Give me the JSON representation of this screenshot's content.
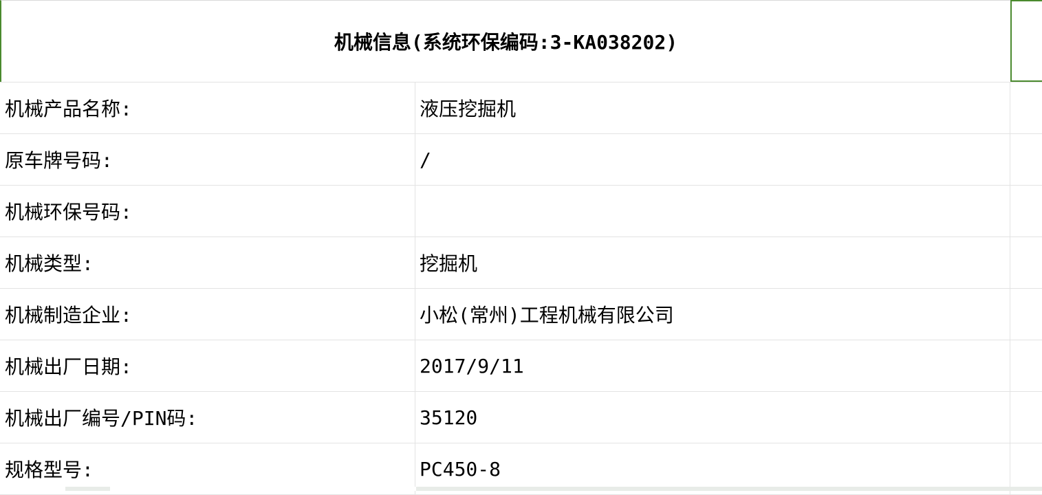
{
  "title": "机械信息(系统环保编码:3-KA038202)",
  "rows": [
    {
      "label": "机械产品名称:",
      "value": "液压挖掘机"
    },
    {
      "label": "原车牌号码:",
      "value": "/"
    },
    {
      "label": "机械环保号码:",
      "value": ""
    },
    {
      "label": "机械类型:",
      "value": "挖掘机"
    },
    {
      "label": "机械制造企业:",
      "value": "小松(常州)工程机械有限公司"
    },
    {
      "label": "机械出厂日期:",
      "value": "2017/9/11"
    },
    {
      "label": "机械出厂编号/PIN码:",
      "value": "35120"
    },
    {
      "label": "规格型号:",
      "value": "PC450-8"
    }
  ],
  "colors": {
    "selection_border": "#4a8a2e",
    "grid_line": "#e3e3e3"
  }
}
